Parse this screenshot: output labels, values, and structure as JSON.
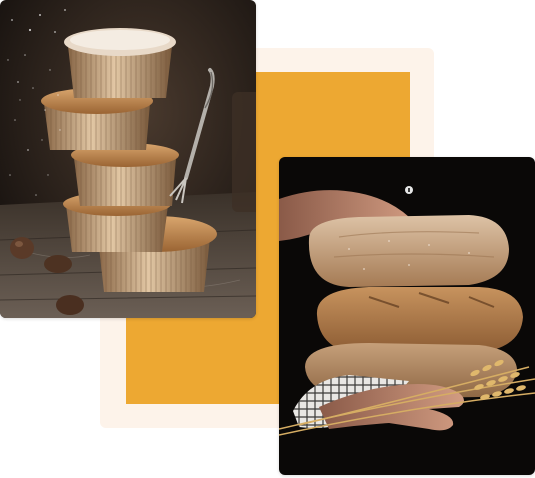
{
  "colors": {
    "cream": "#fdf3ea",
    "orange": "#eda832",
    "muffin_bg_dark": "#1e1916",
    "bread_bg": "#0a0807",
    "crust": "#b67c49",
    "crust_light": "#cfa277",
    "liner": "#c9a27a",
    "skin": "#c48a70"
  },
  "images": [
    {
      "name": "photo-muffins",
      "subject": "stacked-muffins-with-fork-and-powdered-sugar"
    },
    {
      "name": "photo-bread",
      "subject": "hands-holding-stacked-sourdough-loaves-with-wheat"
    }
  ]
}
